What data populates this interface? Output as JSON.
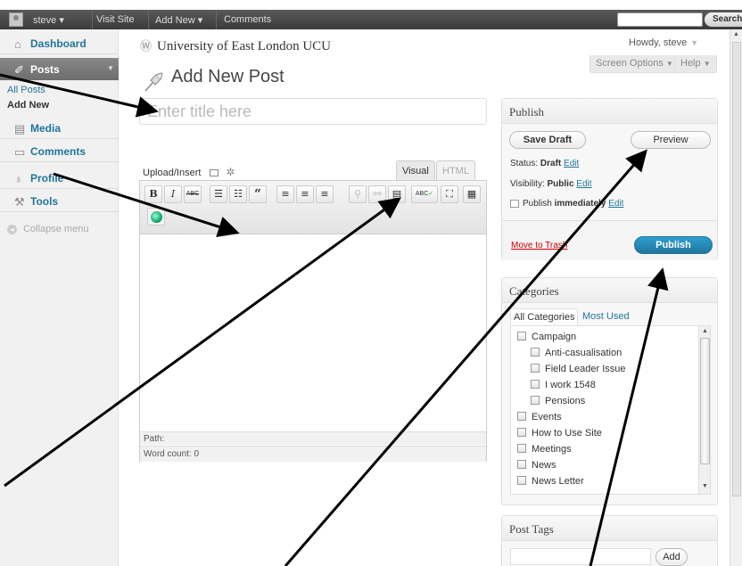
{
  "admin_bar": {
    "user": "steve",
    "user_caret": "▾",
    "visit_site": "Visit Site",
    "add_new": "Add New",
    "add_new_caret": "▾",
    "comments": "Comments",
    "search_button": "Search"
  },
  "sidebar": {
    "dashboard": "Dashboard",
    "posts": "Posts",
    "all_posts": "All Posts",
    "add_new": "Add New",
    "media": "Media",
    "comments": "Comments",
    "profile": "Profile",
    "tools": "Tools",
    "collapse": "Collapse menu"
  },
  "header": {
    "site_name": "University of East London UCU",
    "howdy": "Howdy, steve",
    "screen_options": "Screen Options",
    "help": "Help"
  },
  "page_title": "Add New Post",
  "title_field": {
    "placeholder": "Enter title here"
  },
  "editor": {
    "upload_insert": "Upload/Insert",
    "tab_visual": "Visual",
    "tab_html": "HTML",
    "toolbar": {
      "bold": "B",
      "italic": "I",
      "strike": "ABC",
      "quote": "“",
      "spell": "ABC"
    },
    "path_label": "Path:",
    "word_count": "Word count: 0"
  },
  "publish": {
    "heading": "Publish",
    "save_draft": "Save Draft",
    "preview": "Preview",
    "status_label": "Status:",
    "status_value": "Draft",
    "visibility_label": "Visibility:",
    "visibility_value": "Public",
    "publish_label": "Publish",
    "publish_when": "immediately",
    "edit": "Edit",
    "move_to_trash": "Move to Trash",
    "publish_button": "Publish"
  },
  "categories": {
    "heading": "Categories",
    "tab_all": "All Categories",
    "tab_popular": "Most Used",
    "items": [
      {
        "label": "Campaign",
        "level": 0
      },
      {
        "label": "Anti-casualisation",
        "level": 1
      },
      {
        "label": "Field Leader Issue",
        "level": 1
      },
      {
        "label": "I work 1548",
        "level": 1
      },
      {
        "label": "Pensions",
        "level": 1
      },
      {
        "label": "Events",
        "level": 0
      },
      {
        "label": "How to Use Site",
        "level": 0
      },
      {
        "label": "Meetings",
        "level": 0
      },
      {
        "label": "News",
        "level": 0
      },
      {
        "label": "News Letter",
        "level": 0
      }
    ]
  },
  "tags": {
    "heading": "Post Tags",
    "add": "Add"
  }
}
